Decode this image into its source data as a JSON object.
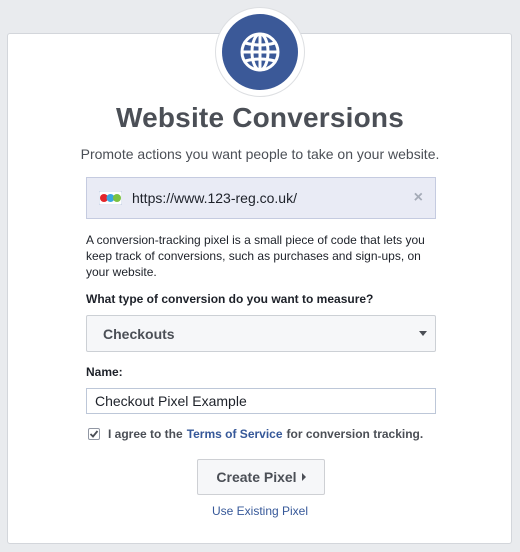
{
  "header": {
    "title": "Website Conversions",
    "subtitle": "Promote actions you want people to take on your website.",
    "icon": "globe-icon",
    "accent_color": "#3b5998"
  },
  "url_box": {
    "favicon": "123-reg-favicon",
    "url": "https://www.123-reg.co.uk/",
    "remove_glyph": "×"
  },
  "description": "A conversion-tracking pixel is a small piece of code that lets you keep track of conversions, such as purchases and sign-ups, on your website.",
  "conversion_type": {
    "label": "What type of conversion do you want to measure?",
    "selected": "Checkouts"
  },
  "name_field": {
    "label": "Name:",
    "value": "Checkout Pixel Example"
  },
  "agreement": {
    "checked": true,
    "prefix": "I agree to the",
    "link": "Terms of Service",
    "suffix": "for conversion tracking."
  },
  "actions": {
    "create_label": "Create Pixel",
    "existing_label": "Use Existing Pixel"
  }
}
